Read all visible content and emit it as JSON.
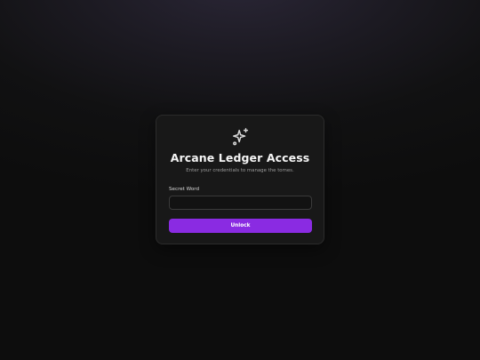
{
  "card": {
    "icon": "sparkles-icon",
    "title": "Arcane Ledger Access",
    "subtitle": "Enter your credentials to manage the tomes.",
    "field_label": "Secret Word",
    "field_value": "",
    "field_placeholder": "",
    "button_label": "Unlock"
  },
  "colors": {
    "accent": "#8a2be2",
    "card_background": "#181818",
    "page_background": "#0d0d0d"
  }
}
